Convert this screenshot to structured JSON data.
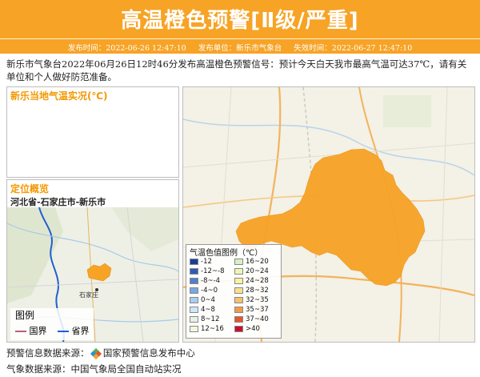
{
  "header": {
    "title": "高温橙色预警[Ⅱ级/严重]",
    "publish_time": "发布时间：2022-06-26 12:47:10",
    "publisher": "发布单位：新乐市气象台",
    "expire_time": "失效时间：2022-06-27 12:47:10",
    "bg_color": "#f7a326"
  },
  "description": "新乐市气象台2022年06月26日12时46分发布高温橙色预警信号：预计今天白天我市最高气温可达37℃，请有关单位和个人做好防范准备。",
  "temp_panel": {
    "title": "新乐当地气温实况(℃)"
  },
  "location_panel": {
    "title": "定位概览",
    "region": "河北省-石家庄市-新乐市",
    "map_label_city": "石家庄",
    "legend_title": "图例",
    "legend_items": [
      {
        "label": "国界",
        "color": "#b5627a"
      },
      {
        "label": "省界",
        "color": "#1f5fd1"
      }
    ]
  },
  "main_map": {
    "legend_title": "气温色值图例（℃）",
    "legend_left": [
      {
        "label": "-12",
        "color": "#1a3f8f"
      },
      {
        "label": "-12~-8",
        "color": "#2e5bb5"
      },
      {
        "label": "-8~-4",
        "color": "#4f7fd0"
      },
      {
        "label": "-4~0",
        "color": "#7aa6e3"
      },
      {
        "label": "0~4",
        "color": "#a9cdf0"
      },
      {
        "label": "4~8",
        "color": "#cfe6f7"
      },
      {
        "label": "8~12",
        "color": "#e6f3e4"
      },
      {
        "label": "12~16",
        "color": "#f3f8d8"
      }
    ],
    "legend_right": [
      {
        "label": "16~20",
        "color": "#d7f0c5"
      },
      {
        "label": "20~24",
        "color": "#eef7b2"
      },
      {
        "label": "24~28",
        "color": "#fbf2a1"
      },
      {
        "label": "28~32",
        "color": "#fbe08a"
      },
      {
        "label": "32~35",
        "color": "#f8c06a"
      },
      {
        "label": "35~37",
        "color": "#f39a4a"
      },
      {
        "label": "37~40",
        "color": "#e8542b"
      },
      {
        "label": ">40",
        "color": "#c8102e"
      }
    ],
    "area_color": "#f7a326"
  },
  "footer": {
    "warning_source_label": "预警信息数据来源：",
    "warning_source": "国家预警信息发布中心",
    "weather_source_label": "气象数据来源：",
    "weather_source": "中国气象局全国自动站实况"
  }
}
